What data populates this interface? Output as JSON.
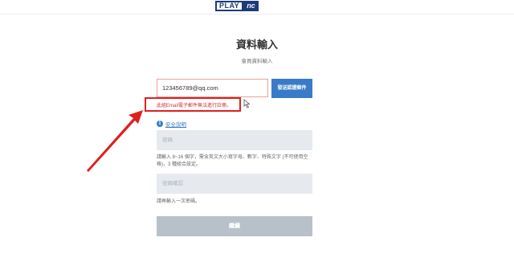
{
  "header": {
    "logo_play": "PLAY",
    "logo_nc": "nc"
  },
  "page": {
    "title": "資料輸入",
    "subtitle": "會員資料輸入"
  },
  "form": {
    "email_value": "123456789@qq.com",
    "send_button_label": "發送認證郵件",
    "email_error": "此組Email電子郵件無法進行註冊。",
    "security_icon_glyph": "i",
    "security_link": "安全說明",
    "password_placeholder": "密碼",
    "password_hint": "請輸入 8~16 個字，需含英文大小寫字母、數字、特殊文字 (不可使用空格)，3 種組合設定。",
    "confirm_placeholder": "密碼確認",
    "confirm_hint": "請再輸入一次密碼。",
    "continue_button_label": "繼續"
  },
  "colors": {
    "accent": "#3a7bc8",
    "error": "#e02020",
    "brand": "#1d3a7a",
    "disabled_button": "#b8c1c9"
  }
}
